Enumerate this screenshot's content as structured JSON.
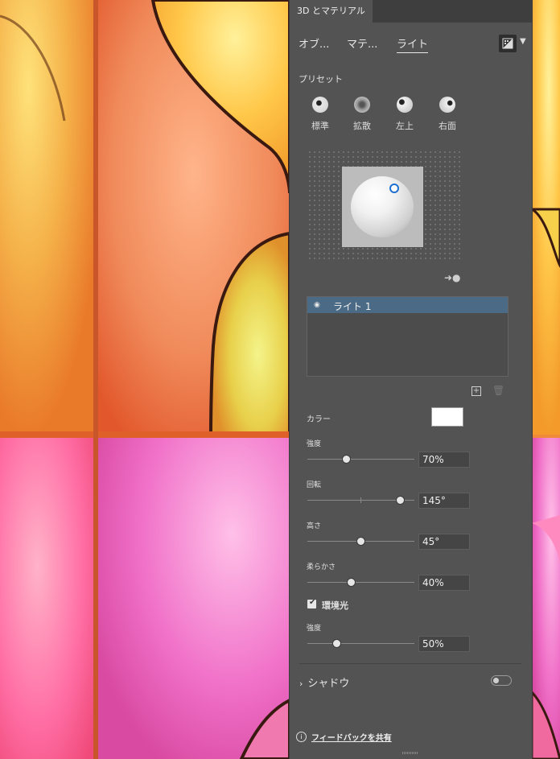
{
  "panel": {
    "tab_title": "3D とマテリアル",
    "nav": [
      {
        "label": "オブ..."
      },
      {
        "label": "マテ..."
      },
      {
        "label": "ライト"
      }
    ],
    "preset_label": "プリセット",
    "presets": [
      {
        "label": "標準"
      },
      {
        "label": "拡散"
      },
      {
        "label": "左上"
      },
      {
        "label": "右面"
      }
    ],
    "lights": [
      {
        "name": "ライト 1"
      }
    ],
    "color_label": "カラー",
    "color_value": "#ffffff",
    "intensity_label": "強度",
    "intensity_value": "70%",
    "intensity_level": 70,
    "rotation_label": "回転",
    "rotation_value": "145°",
    "rotation_level": 145,
    "height_label": "高さ",
    "height_value": "45°",
    "height_level": 45,
    "softness_label": "柔らかさ",
    "softness_value": "40%",
    "softness_level": 40,
    "ambient_label": "環境光",
    "ambient_checked": true,
    "ambient_intensity_label": "強度",
    "ambient_intensity_value": "50%",
    "ambient_intensity_level": 50,
    "shadow_label": "シャドウ",
    "shadow_enabled": false,
    "feedback_label": "フィードバックを共有"
  },
  "colors": {
    "panel_bg": "#535353",
    "accent_blue": "#1f6fd1",
    "list_selected": "#4a6a86"
  }
}
